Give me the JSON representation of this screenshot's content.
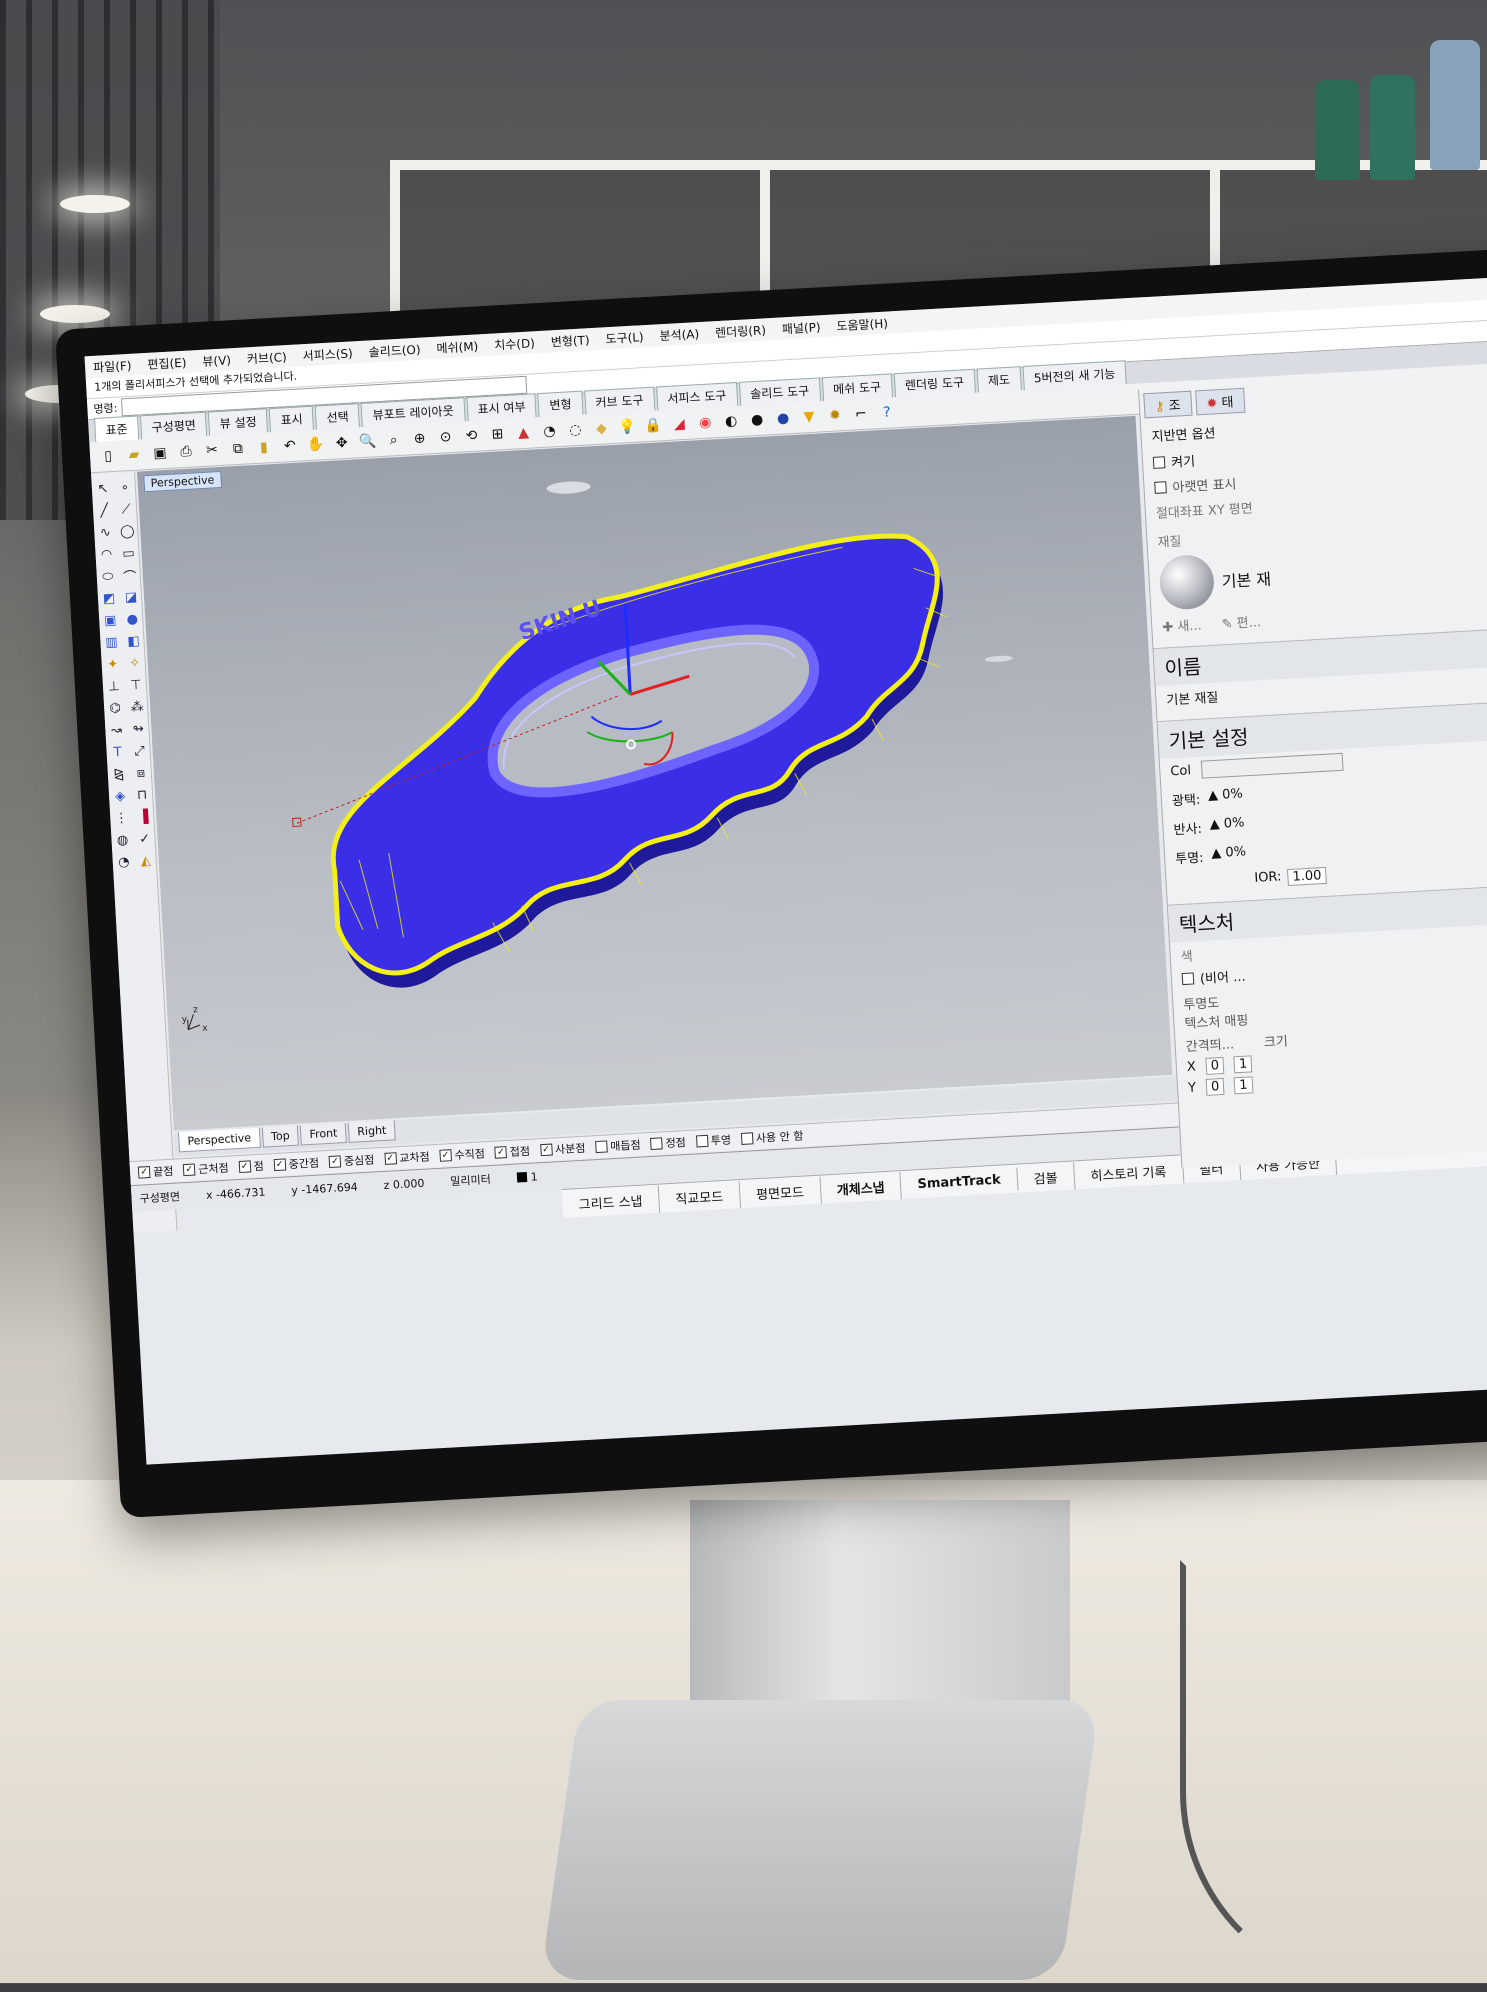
{
  "menu": [
    "파일(F)",
    "편집(E)",
    "뷰(V)",
    "커브(C)",
    "서피스(S)",
    "솔리드(O)",
    "메쉬(M)",
    "치수(D)",
    "변형(T)",
    "도구(L)",
    "분석(A)",
    "렌더링(R)",
    "패널(P)",
    "도움말(H)"
  ],
  "command_history": "1개의 폴리서피스가 선택에 추가되었습니다.",
  "command_prompt": "명령:",
  "toolbar_tabs": [
    "표준",
    "구성평면",
    "뷰 설정",
    "표시",
    "선택",
    "뷰포트 레이아웃",
    "표시 여부",
    "변형",
    "커브 도구",
    "서피스 도구",
    "솔리드 도구",
    "메쉬 도구",
    "렌더링 도구",
    "제도",
    "5버전의 새 기능"
  ],
  "viewport": {
    "label": "Perspective",
    "model_text": "SKIN U",
    "axis_x": "x",
    "axis_y": "y",
    "axis_z": "z",
    "tabs": [
      "Perspective",
      "Top",
      "Front",
      "Right"
    ]
  },
  "osnap": [
    "끝점",
    "근처점",
    "점",
    "중간점",
    "중심점",
    "교차점",
    "수직점",
    "접점",
    "사분점",
    "매듭점",
    "정점",
    "투영",
    "사용 안 함"
  ],
  "status": {
    "cplane": "구성평면",
    "x": "x -466.731",
    "y": "y -1467.694",
    "z": "z 0.000",
    "units": "밀리미터",
    "layer": "1"
  },
  "status_buttons": [
    "그리드 스냅",
    "직교모드",
    "평면모드",
    "개체스냅",
    "SmartTrack",
    "검볼",
    "히스토리 기록",
    "필터",
    "사용 가능한"
  ],
  "right_panel": {
    "tabs": [
      "조",
      "태"
    ],
    "section1_title": "지반면 옵션",
    "on_label": "켜기",
    "underside_label": "아랫면 표시",
    "abs_xy_label": "절대좌표 XY 평면",
    "material_label": "재질",
    "material_name": "기본 재",
    "new_label": "새...",
    "edit_label": "편...",
    "name_header": "이름",
    "name_value": "기본 재질",
    "basic_header": "기본 설정",
    "col_label": "Col",
    "gloss_label": "광택:",
    "reflect_label": "반사:",
    "transp_label": "투명:",
    "pct": "0%",
    "ior_label": "IOR:",
    "ior_value": "1.00",
    "texture_header": "텍스처",
    "color_label": "색",
    "empty_label": "(비어 ...",
    "transparency_label": "투명도",
    "texture_map_label": "텍스처 매핑",
    "spacing_label": "간격띄...",
    "size_label": "크기",
    "x_label": "X",
    "y_label": "Y",
    "zero": "0",
    "one": "1"
  }
}
